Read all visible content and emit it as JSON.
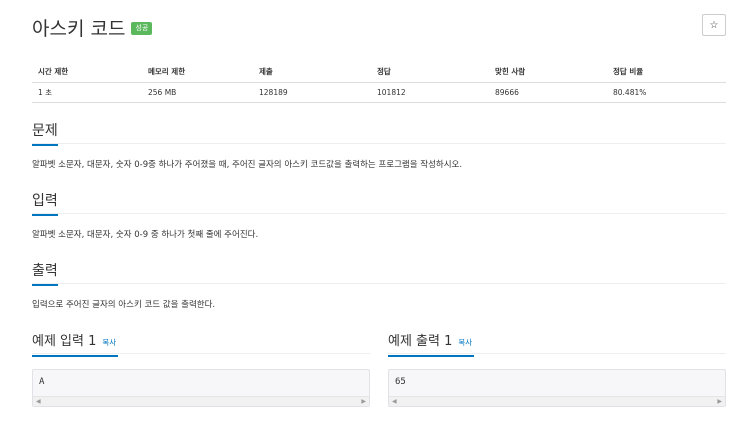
{
  "problem": {
    "title": "아스키 코드",
    "status_badge": "성공",
    "star_label": "☆"
  },
  "info_table": {
    "headers": [
      "시간 제한",
      "메모리 제한",
      "제출",
      "정답",
      "맞힌 사람",
      "정답 비율"
    ],
    "values": [
      "1 초",
      "256 MB",
      "128189",
      "101812",
      "89666",
      "80.481%"
    ]
  },
  "sections": {
    "description": {
      "title": "문제",
      "text": "알파벳 소문자, 대문자, 숫자 0-9중 하나가 주어졌을 때, 주어진 글자의 아스키 코드값을 출력하는 프로그램을 작성하시오."
    },
    "input": {
      "title": "입력",
      "text": "알파벳 소문자, 대문자, 숫자 0-9 중 하나가 첫째 줄에 주어진다."
    },
    "output": {
      "title": "출력",
      "text": "입력으로 주어진 글자의 아스키 코드 값을 출력한다."
    }
  },
  "samples": {
    "input": {
      "title": "예제 입력 1",
      "copy": "복사",
      "content": "A"
    },
    "output": {
      "title": "예제 출력 1",
      "copy": "복사",
      "content": "65"
    }
  },
  "colors": {
    "accent": "#0076c0",
    "success_badge": "#5cb85c"
  },
  "icons": {
    "star": "star-icon",
    "scroll_left": "left-arrow-icon",
    "scroll_right": "right-arrow-icon"
  }
}
